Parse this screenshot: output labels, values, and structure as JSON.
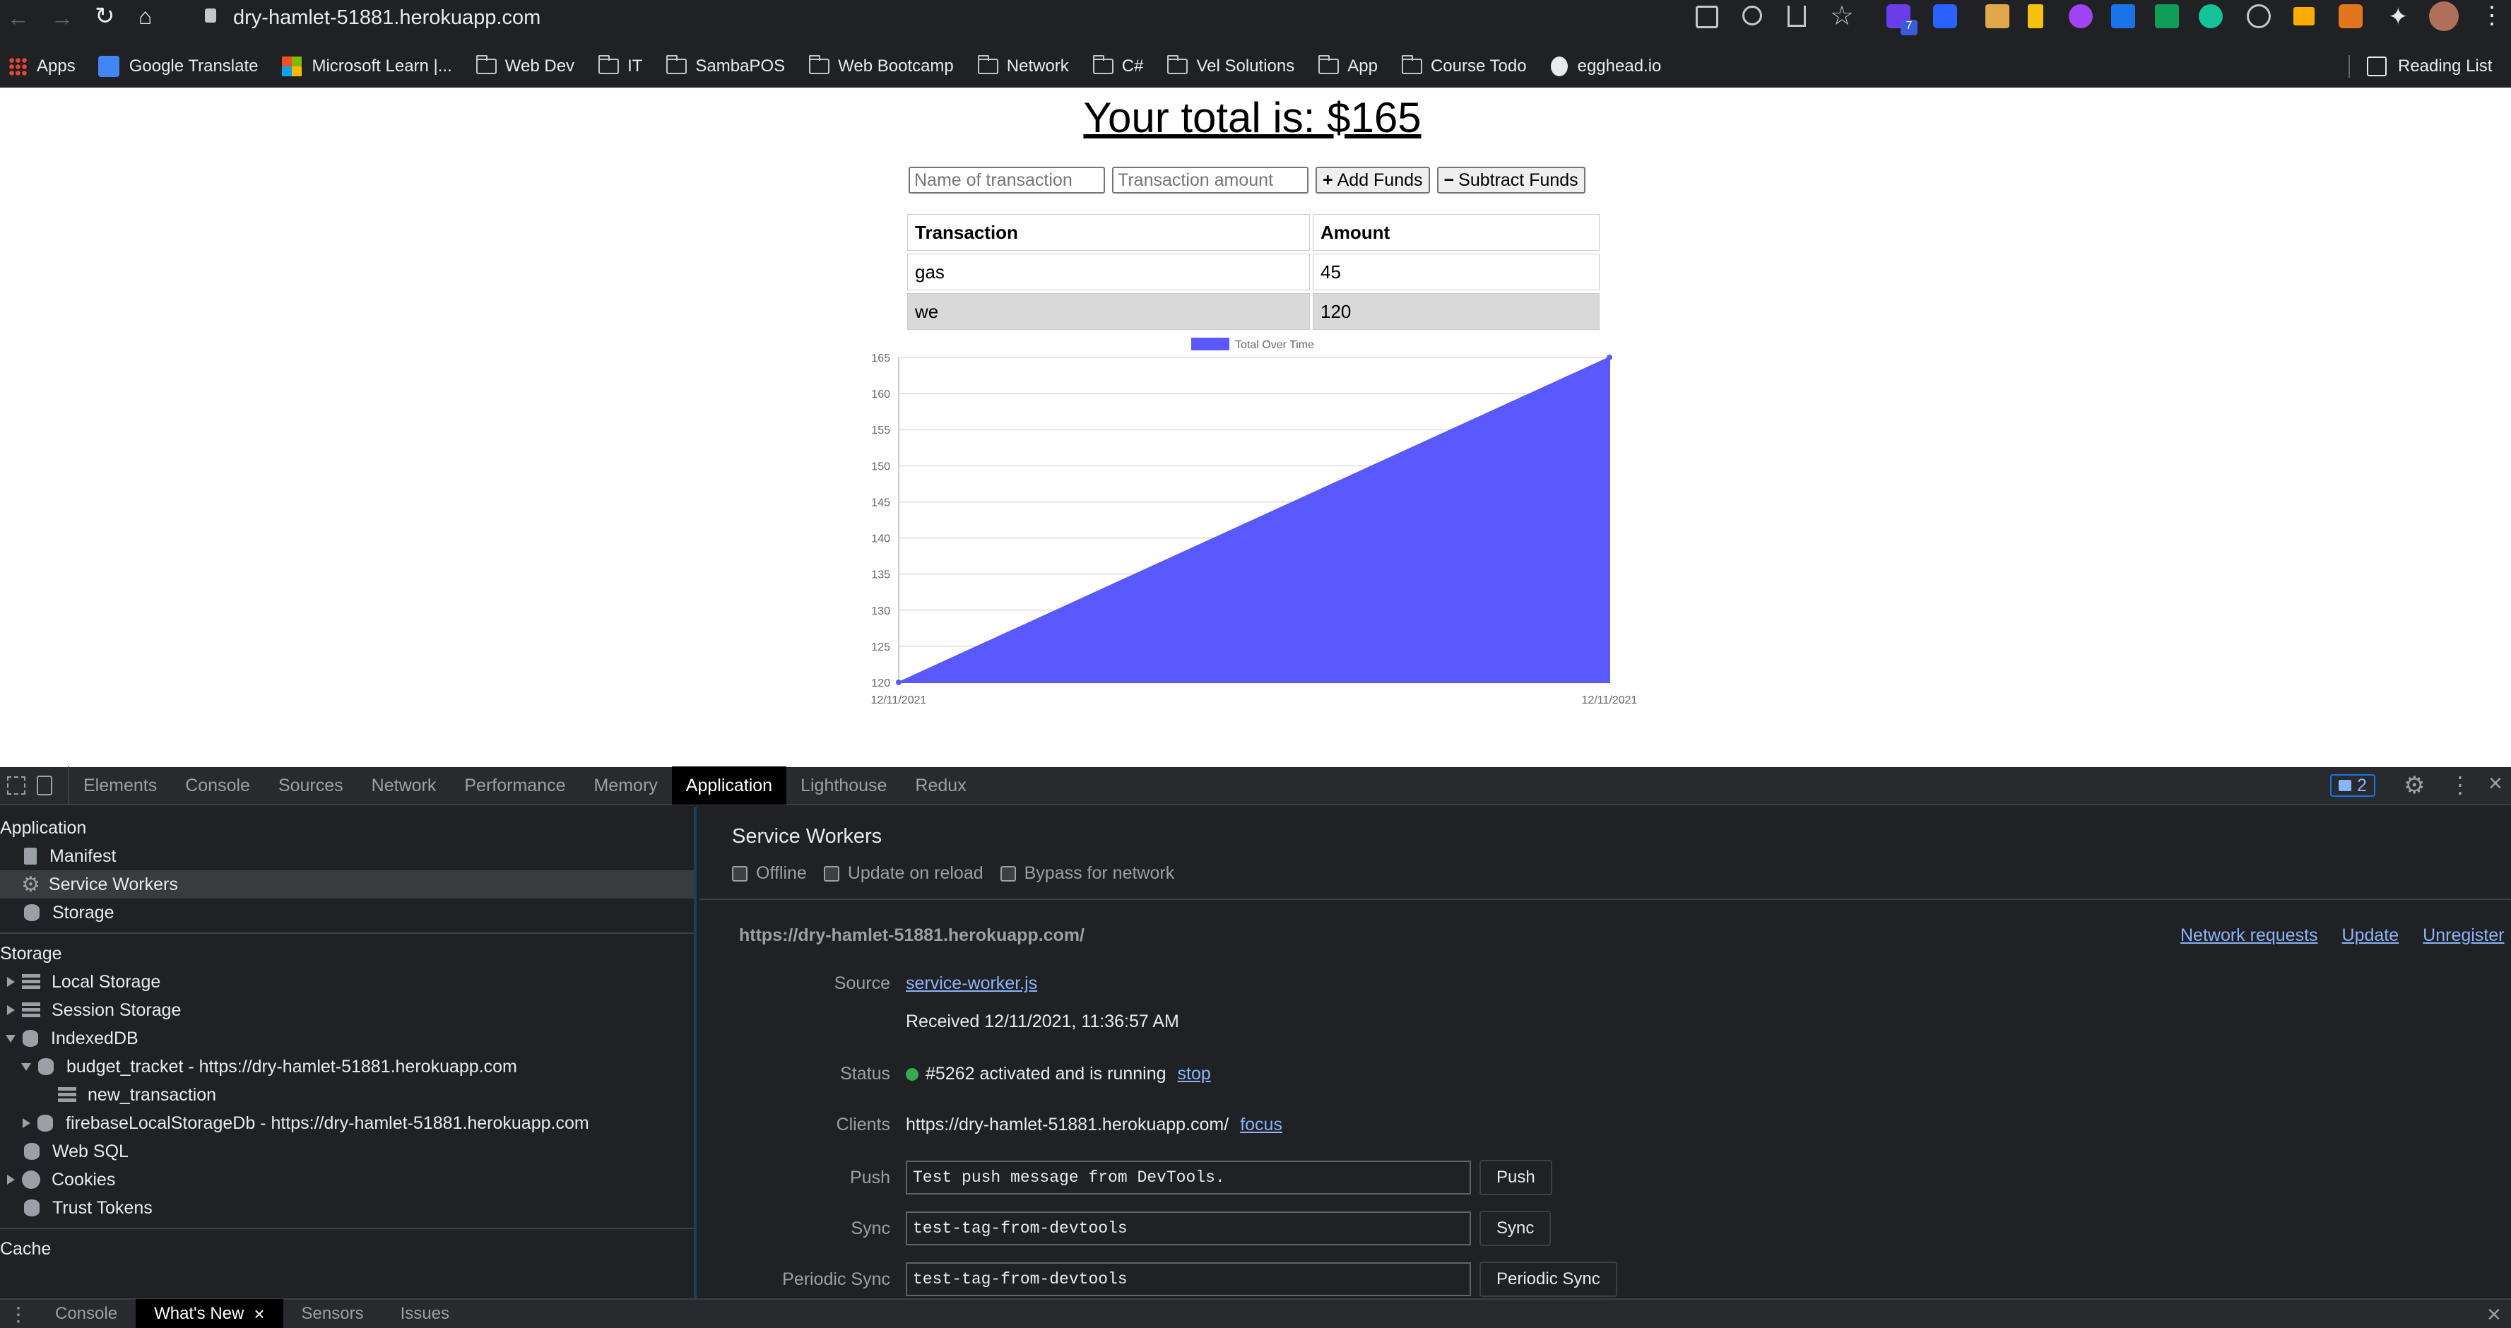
{
  "browser": {
    "url": "dry-hamlet-51881.herokuapp.com",
    "bookmarks": [
      "Apps",
      "Google Translate",
      "Microsoft Learn |...",
      "Web Dev",
      "IT",
      "SambaPOS",
      "Web Bootcamp",
      "Network",
      "C#",
      "Vel Solutions",
      "App",
      "Course Todo",
      "egghead.io"
    ],
    "reading_list": "Reading List",
    "extension_badge": "7"
  },
  "app": {
    "title": "Your total is: $165",
    "name_placeholder": "Name of transaction",
    "amount_placeholder": "Transaction amount",
    "add_label": "Add Funds",
    "subtract_label": "Subtract Funds",
    "table": {
      "headers": [
        "Transaction",
        "Amount"
      ],
      "rows": [
        [
          "gas",
          "45"
        ],
        [
          "we",
          "120"
        ]
      ]
    }
  },
  "chart_data": {
    "type": "area",
    "series": [
      {
        "name": "Total Over Time",
        "values": [
          120,
          165
        ]
      }
    ],
    "categories": [
      "12/11/2021",
      "12/11/2021"
    ],
    "yticks": [
      120,
      125,
      130,
      135,
      140,
      145,
      150,
      155,
      160,
      165
    ],
    "ylim": [
      120,
      165
    ],
    "legend": "top",
    "color": "#5959ff"
  },
  "devtools": {
    "tabs": [
      "Elements",
      "Console",
      "Sources",
      "Network",
      "Performance",
      "Memory",
      "Application",
      "Lighthouse",
      "Redux"
    ],
    "active_tab": "Application",
    "issues_count": "2",
    "sidebar": {
      "application_heading": "Application",
      "application_items": [
        "Manifest",
        "Service Workers",
        "Storage"
      ],
      "storage_heading": "Storage",
      "storage_items": [
        "Local Storage",
        "Session Storage",
        "IndexedDB",
        "budget_tracket - https://dry-hamlet-51881.herokuapp.com",
        "new_transaction",
        "firebaseLocalStorageDb - https://dry-hamlet-51881.herokuapp.com",
        "Web SQL",
        "Cookies",
        "Trust Tokens"
      ],
      "cache_heading": "Cache"
    },
    "sw": {
      "heading": "Service Workers",
      "options": [
        "Offline",
        "Update on reload",
        "Bypass for network"
      ],
      "origin": "https://dry-hamlet-51881.herokuapp.com/",
      "actions": [
        "Network requests",
        "Update",
        "Unregister"
      ],
      "source_label": "Source",
      "source_link": "service-worker.js",
      "received": "Received 12/11/2021, 11:36:57 AM",
      "status_label": "Status",
      "status_text": "#5262 activated and is running",
      "status_link": "stop",
      "clients_label": "Clients",
      "clients_text": "https://dry-hamlet-51881.herokuapp.com/",
      "clients_link": "focus",
      "push_label": "Push",
      "push_value": "Test push message from DevTools.",
      "push_button": "Push",
      "sync_label": "Sync",
      "sync_value": "test-tag-from-devtools",
      "sync_button": "Sync",
      "periodic_label": "Periodic Sync",
      "periodic_value": "test-tag-from-devtools",
      "periodic_button": "Periodic Sync"
    },
    "drawer_tabs": [
      "Console",
      "What's New",
      "Sensors",
      "Issues"
    ],
    "drawer_active": "What's New"
  }
}
